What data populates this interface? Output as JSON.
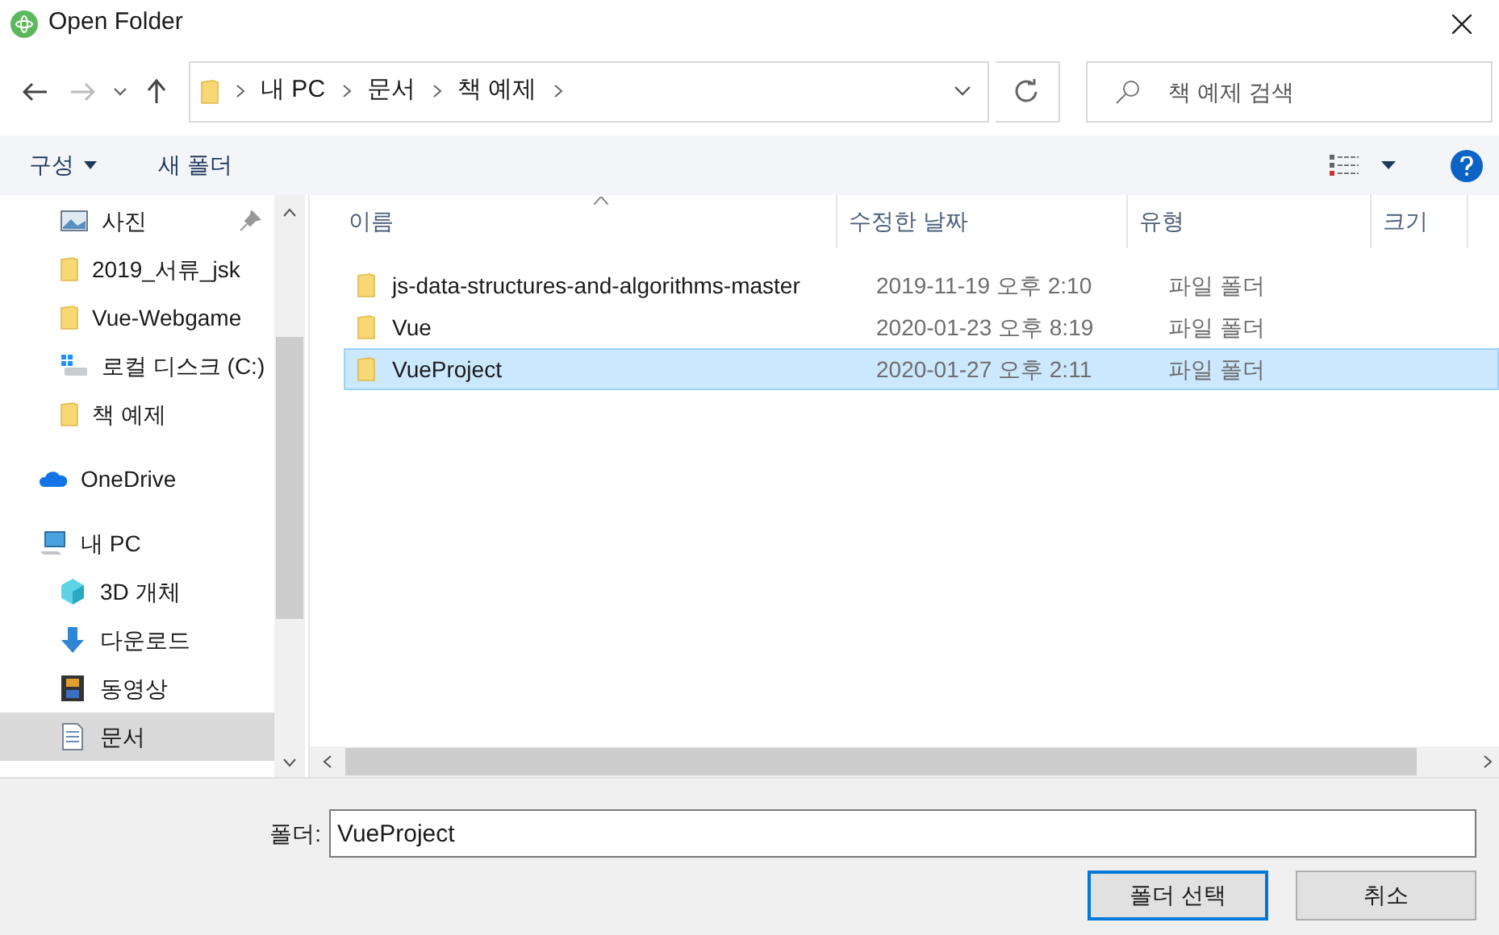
{
  "window": {
    "title": "Open Folder"
  },
  "address_bar": {
    "path": [
      "내 PC",
      "문서",
      "책 예제"
    ]
  },
  "search": {
    "placeholder": "책 예제 검색"
  },
  "toolbar": {
    "organize": "구성",
    "new_folder": "새 폴더"
  },
  "quick_access": [
    {
      "label": "사진",
      "kind": "picture",
      "pinned": true,
      "selected": false
    },
    {
      "label": "2019_서류_jsk",
      "kind": "folder",
      "pinned": false,
      "selected": false
    },
    {
      "label": "Vue-Webgame",
      "kind": "folder",
      "pinned": false,
      "selected": false
    },
    {
      "label": "로컬 디스크 (C:)",
      "kind": "drive",
      "pinned": false,
      "selected": false
    },
    {
      "label": "책 예제",
      "kind": "folder",
      "pinned": false,
      "selected": false
    }
  ],
  "nav_tree": [
    {
      "label": "OneDrive",
      "kind": "cloud",
      "selected": false
    },
    {
      "label": "내 PC",
      "kind": "pc",
      "selected": false,
      "children": [
        {
          "label": "3D 개체",
          "kind": "cube",
          "selected": false
        },
        {
          "label": "다운로드",
          "kind": "download",
          "selected": false
        },
        {
          "label": "동영상",
          "kind": "video",
          "selected": false
        },
        {
          "label": "문서",
          "kind": "document",
          "selected": true
        }
      ]
    }
  ],
  "table": {
    "columns": [
      "이름",
      "수정한 날짜",
      "유형",
      "크기"
    ],
    "rows": [
      {
        "name": "js-data-structures-and-algorithms-master",
        "modified": "2019-11-19 오후 2:10",
        "type": "파일 폴더",
        "selected": false
      },
      {
        "name": "Vue",
        "modified": "2020-01-23 오후 8:19",
        "type": "파일 폴더",
        "selected": false
      },
      {
        "name": "VueProject",
        "modified": "2020-01-27 오후 2:11",
        "type": "파일 폴더",
        "selected": true
      }
    ]
  },
  "folder_field": {
    "label": "폴더:",
    "value": "VueProject"
  },
  "buttons": [
    "폴더 선택",
    "취소"
  ]
}
